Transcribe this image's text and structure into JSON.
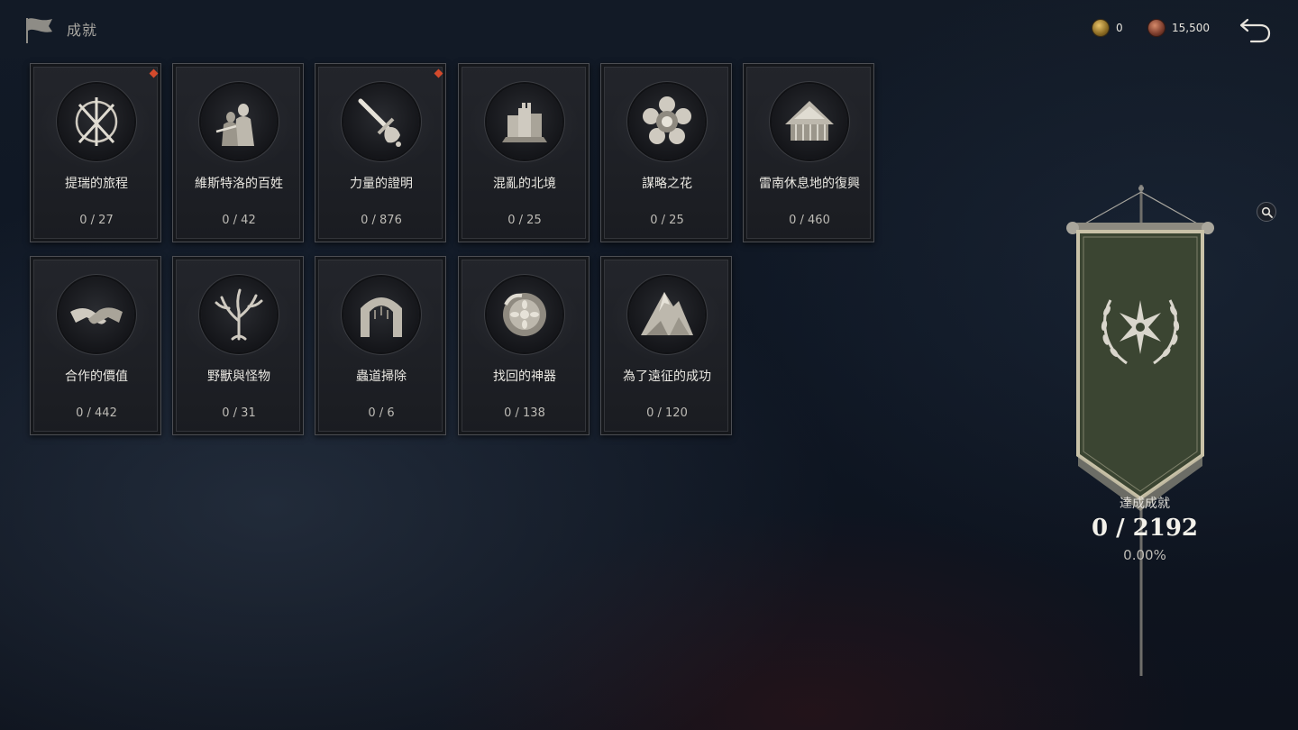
{
  "header": {
    "title": "成就",
    "flag_icon": "flag-icon",
    "back_icon": "back-arrow-icon"
  },
  "currencies": [
    {
      "icon": "gold-coin-icon",
      "value": "0"
    },
    {
      "icon": "copper-coin-icon",
      "value": "15,500"
    }
  ],
  "achievements": [
    {
      "name": "提瑞的旅程",
      "progress": "0 / 27",
      "icon": "crossed-staves-icon",
      "new": true
    },
    {
      "name": "維斯特洛的百姓",
      "progress": "0 / 42",
      "icon": "people-figures-icon",
      "new": false
    },
    {
      "name": "力量的證明",
      "progress": "0 / 876",
      "icon": "sword-hand-icon",
      "new": true
    },
    {
      "name": "混亂的北境",
      "progress": "0 / 25",
      "icon": "castle-icon",
      "new": false
    },
    {
      "name": "謀略之花",
      "progress": "0 / 25",
      "icon": "rose-icon",
      "new": false
    },
    {
      "name": "雷南休息地的復興",
      "progress": "0 / 460",
      "icon": "hall-icon",
      "new": false
    },
    {
      "name": "合作的價值",
      "progress": "0 / 442",
      "icon": "handshake-icon",
      "new": false
    },
    {
      "name": "野獸與怪物",
      "progress": "0 / 31",
      "icon": "dead-tree-icon",
      "new": false
    },
    {
      "name": "蟲道掃除",
      "progress": "0 / 6",
      "icon": "cave-icon",
      "new": false
    },
    {
      "name": "找回的神器",
      "progress": "0 / 138",
      "icon": "artifact-disc-icon",
      "new": false
    },
    {
      "name": "為了遠征的成功",
      "progress": "0 / 120",
      "icon": "mountain-icon",
      "new": false
    }
  ],
  "summary": {
    "label": "達成成就",
    "total": "0 / 2192",
    "percent": "0.00%",
    "banner_icon": "laurel-star-icon"
  },
  "search_icon": "search-icon",
  "colors": {
    "background": "#0f1724",
    "card": "#1f2126",
    "new_badge": "#d34a2c",
    "banner_green": "#3a4431",
    "banner_trim": "#c9c2a8"
  }
}
